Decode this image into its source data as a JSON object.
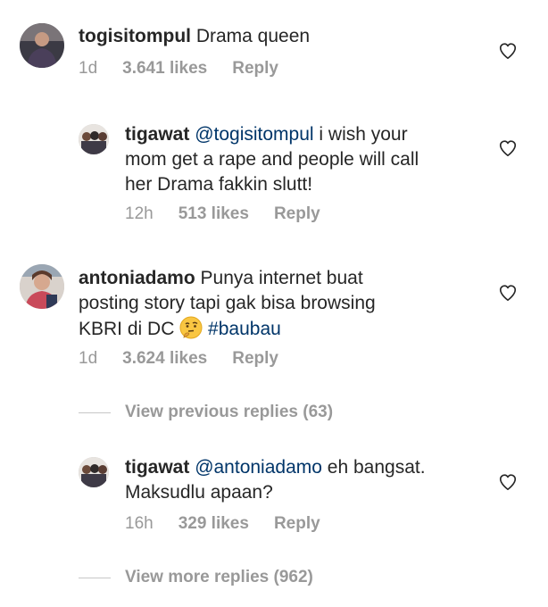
{
  "comments": [
    {
      "username": "togisitompul",
      "text": "Drama queen",
      "time": "1d",
      "likes": "3.641 likes",
      "reply": "Reply",
      "avatar_icon": "user-avatar-man"
    },
    {
      "username": "tigawat",
      "mention": "@togisitompul",
      "text_line1": "i wish your",
      "text_line2": "mom get a rape and people will call",
      "text_line3": "her Drama fakkin slutt!",
      "time": "12h",
      "likes": "513 likes",
      "reply": "Reply",
      "avatar_icon": "user-avatar-group"
    },
    {
      "username": "antoniadamo",
      "text_line1": "Punya internet buat",
      "text_line2": "posting story tapi gak bisa browsing",
      "text_line3": "KBRI di DC",
      "emoji": "thinking-face",
      "hashtag": "#baubau",
      "time": "1d",
      "likes": "3.624 likes",
      "reply": "Reply",
      "avatar_icon": "user-avatar-woman"
    },
    {
      "username": "tigawat",
      "mention": "@antoniadamo",
      "text_line1": "eh bangsat.",
      "text_line2": "Maksudlu apaan?",
      "time": "16h",
      "likes": "329 likes",
      "reply": "Reply",
      "avatar_icon": "user-avatar-group"
    }
  ],
  "view_previous": "View previous replies (63)",
  "view_more": "View more replies (962)",
  "colors": {
    "text": "#262626",
    "meta": "#999999",
    "link": "#003569",
    "divider": "#c7c7c7"
  }
}
